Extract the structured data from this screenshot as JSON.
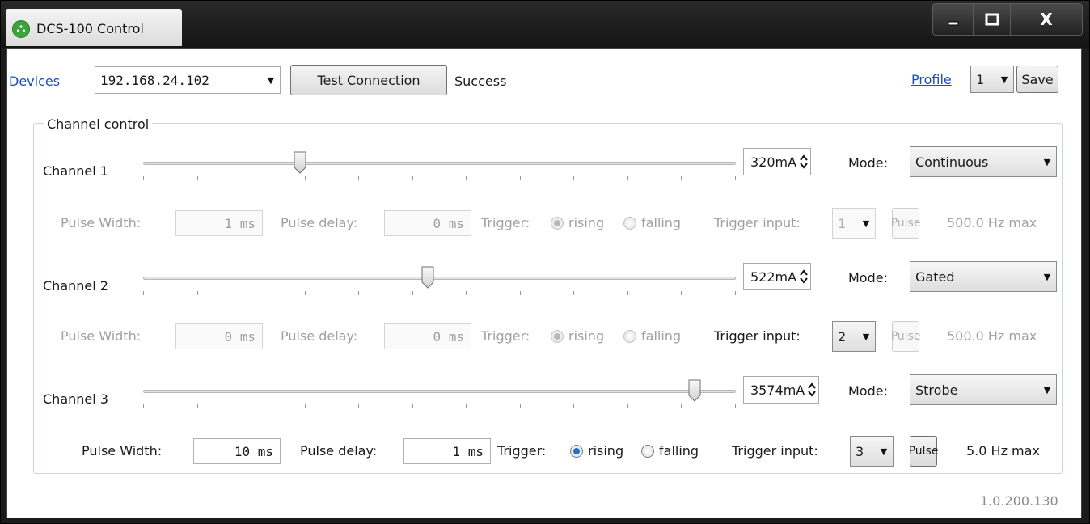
{
  "window": {
    "title": "DCS-100 Control",
    "minimize_glyph": "▁",
    "maximize_glyph": "□",
    "close_glyph": "X"
  },
  "toolbar": {
    "devices_link": "Devices",
    "device_value": "192.168.24.102",
    "test_button": "Test Connection",
    "status": "Success",
    "profile_link": "Profile",
    "profile_value": "1",
    "save_button": "Save",
    "dropdown_glyph": "▼"
  },
  "group": {
    "label": "Channel control"
  },
  "channels": [
    {
      "label": "Channel 1",
      "current": "320mA",
      "slider_fraction": 0.26,
      "mode_label": "Mode:",
      "mode": "Continuous",
      "pulse_width_label": "Pulse Width:",
      "pulse_width": "1 ms",
      "pulse_delay_label": "Pulse delay:",
      "pulse_delay": "0 ms",
      "trigger_label": "Trigger:",
      "rising": "rising",
      "falling": "falling",
      "trigger_input_label": "Trigger input:",
      "trigger_input": "1",
      "pulse_button": "Pulse",
      "max_rate": "500.0 Hz max"
    },
    {
      "label": "Channel 2",
      "current": "522mA",
      "slider_fraction": 0.48,
      "mode_label": "Mode:",
      "mode": "Gated",
      "pulse_width_label": "Pulse Width:",
      "pulse_width": "0 ms",
      "pulse_delay_label": "Pulse delay:",
      "pulse_delay": "0 ms",
      "trigger_label": "Trigger:",
      "rising": "rising",
      "falling": "falling",
      "trigger_input_label": "Trigger input:",
      "trigger_input": "2",
      "pulse_button": "Pulse",
      "max_rate": "500.0 Hz max"
    },
    {
      "label": "Channel 3",
      "current": "3574mA",
      "slider_fraction": 0.94,
      "mode_label": "Mode:",
      "mode": "Strobe",
      "pulse_width_label": "Pulse Width:",
      "pulse_width": "10 ms",
      "pulse_delay_label": "Pulse delay:",
      "pulse_delay": "1 ms",
      "trigger_label": "Trigger:",
      "rising": "rising",
      "falling": "falling",
      "trigger_input_label": "Trigger input:",
      "trigger_input": "3",
      "pulse_button": "Pulse",
      "max_rate": "5.0 Hz max"
    }
  ],
  "version": "1.0.200.130"
}
